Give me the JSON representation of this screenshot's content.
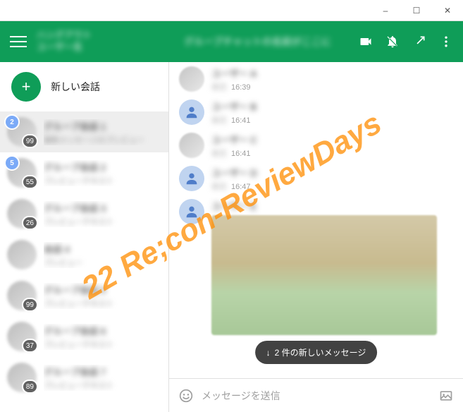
{
  "window": {
    "minimize": "–",
    "maximize": "☐",
    "close": "✕"
  },
  "header": {
    "app_title_line1": "ハングアウト",
    "app_title_line2": "ユーザー名",
    "chat_title": "グループチャットの名前がここに"
  },
  "sidebar": {
    "new_conversation_label": "新しい会話",
    "conversations": [
      {
        "badge": "2",
        "count": "99",
        "name": "グループ会話 1",
        "preview": "最新メッセージのプレビュー"
      },
      {
        "badge": "5",
        "count": "55",
        "name": "グループ会話 2",
        "preview": "プレビューテキスト"
      },
      {
        "badge": "",
        "count": "26",
        "name": "グループ会話 3",
        "preview": "プレビューテキスト"
      },
      {
        "badge": "",
        "count": "",
        "name": "会話 4",
        "preview": "プレビュー"
      },
      {
        "badge": "",
        "count": "99",
        "name": "グループ会話 5",
        "preview": "プレビューテキスト"
      },
      {
        "badge": "",
        "count": "37",
        "name": "グループ会話 6",
        "preview": "プレビューテキスト"
      },
      {
        "badge": "",
        "count": "89",
        "name": "グループ会話 7",
        "preview": "プレビューテキスト"
      }
    ]
  },
  "messages": [
    {
      "name": "ユーザー A",
      "meta_blur": "本文",
      "time": "16:39",
      "generic": false
    },
    {
      "name": "ユーザー B",
      "meta_blur": "本文",
      "time": "16:41",
      "generic": true
    },
    {
      "name": "ユーザー C",
      "meta_blur": "本文",
      "time": "16:41",
      "generic": false
    },
    {
      "name": "ユーザー D",
      "meta_blur": "本文",
      "time": "16:47",
      "generic": true
    },
    {
      "name": "ユーザー E",
      "meta_blur": "",
      "time": "",
      "generic": true,
      "image": true
    }
  ],
  "new_messages_pill": "2 件の新しいメッセージ",
  "composer": {
    "placeholder": "メッセージを送信"
  },
  "watermark": "22 Re;con-ReviewDays"
}
